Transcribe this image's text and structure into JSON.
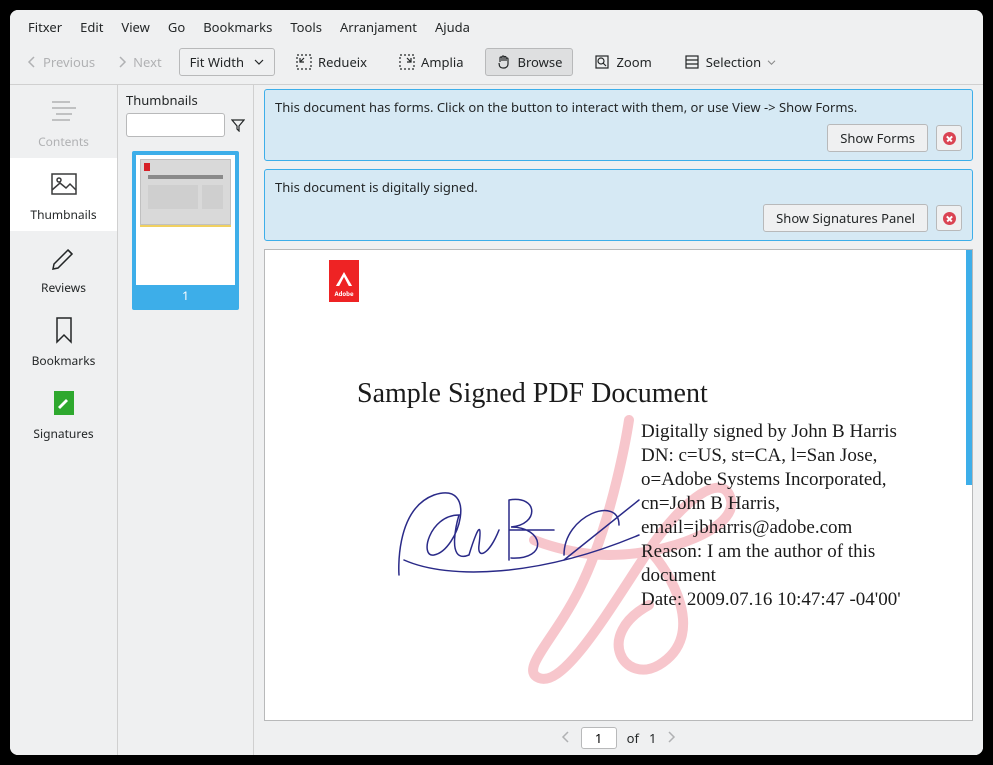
{
  "menubar": [
    "Fitxer",
    "Edit",
    "View",
    "Go",
    "Bookmarks",
    "Tools",
    "Arranjament",
    "Ajuda"
  ],
  "navPrev": "Previous",
  "navNext": "Next",
  "fitMode": "Fit Width",
  "toolbar": {
    "redueix": "Redueix",
    "amplia": "Amplia",
    "browse": "Browse",
    "zoom": "Zoom",
    "selection": "Selection"
  },
  "sidebar": {
    "contents": "Contents",
    "thumbnails": "Thumbnails",
    "reviews": "Reviews",
    "bookmarks": "Bookmarks",
    "signatures": "Signatures"
  },
  "thumbs": {
    "title": "Thumbnails",
    "page1": "1"
  },
  "banners": {
    "forms": "This document has forms. Click on the button to interact with them, or use View -> Show Forms.",
    "showForms": "Show Forms",
    "signed": "This document is digitally signed.",
    "showSignatures": "Show Signatures Panel"
  },
  "document": {
    "title": "Sample Signed PDF Document",
    "adobeText": "Adobe",
    "sigDetails": "Digitally signed by John B Harris\nDN: c=US, st=CA, l=San Jose, o=Adobe Systems Incorporated, cn=John B Harris, email=jbharris@adobe.com\nReason: I am the author of this document\nDate: 2009.07.16 10:47:47 -04'00'"
  },
  "pager": {
    "current": "1",
    "of": "of",
    "total": "1"
  }
}
